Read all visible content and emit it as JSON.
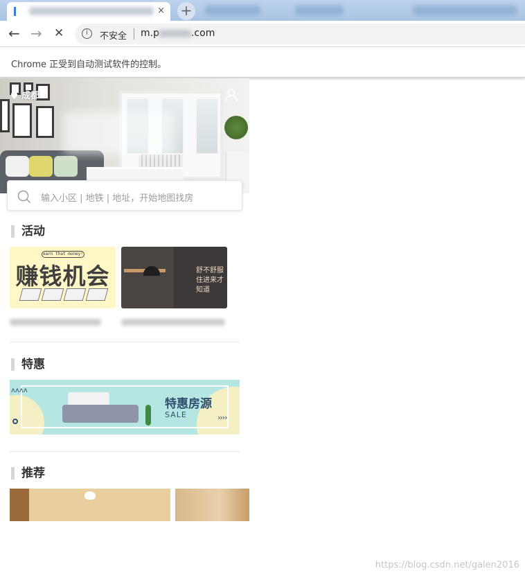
{
  "browser": {
    "tab_close_glyph": "×",
    "new_tab_glyph": "+",
    "back_glyph": "←",
    "forward_glyph": "→",
    "stop_glyph": "✕",
    "insecure_label": "不安全",
    "url_prefix": "m.p",
    "url_suffix": ".com",
    "info_glyph": "i"
  },
  "infobar": {
    "message": "Chrome 正受到自动测试软件的控制。"
  },
  "page": {
    "city": "成都",
    "search_placeholder": "输入小区 | 地铁 | 地址，开始地图找房",
    "sections": {
      "activity": "活动",
      "deals": "特惠",
      "recommend": "推荐"
    },
    "card1": {
      "tag": "earn that money!",
      "title": "赚钱机会"
    },
    "card2": {
      "line1": "舒不舒服",
      "line2": "住进来才知道"
    },
    "promo": {
      "title": "特惠房源",
      "subtitle": "SALE",
      "arrows": "››››",
      "zigzag": "ʌʌʌʌ"
    },
    "accent_colors": {
      "promo_bg": "#b6e6e2",
      "card1_bg": "#fff7c6",
      "section_bar": "#d6d6d6"
    }
  },
  "watermark": "https://blog.csdn.net/galen2016"
}
